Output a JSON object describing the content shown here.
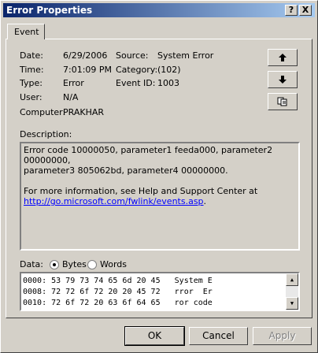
{
  "window": {
    "title": "Error Properties",
    "help_btn": "?",
    "close_btn": "X"
  },
  "tabs": [
    {
      "label": "Event"
    }
  ],
  "event": {
    "date_label": "Date:",
    "date": "6/29/2006",
    "time_label": "Time:",
    "time": "7:01:09 PM",
    "type_label": "Type:",
    "type": "Error",
    "user_label": "User:",
    "user": "N/A",
    "computer_label": "Computer:",
    "computer": "PRAKHAR",
    "source_label": "Source:",
    "source": "System Error",
    "category_label": "Category:",
    "category": "(102)",
    "eventid_label": "Event ID:",
    "eventid": "1003"
  },
  "description": {
    "label": "Description:",
    "line1": "Error code 10000050, parameter1 feeda000, parameter2 00000000,",
    "line2": "parameter3 805062bd, parameter4 00000000.",
    "line3": "For more information, see Help and Support Center at",
    "link": "http://go.microsoft.com/fwlink/events.asp",
    "link_suffix": "."
  },
  "data_section": {
    "label": "Data:",
    "bytes_label": "Bytes",
    "words_label": "Words",
    "selected": "Bytes",
    "rows": [
      "0000: 53 79 73 74 65 6d 20 45   System E",
      "0008: 72 72 6f 72 20 20 45 72   rror  Er",
      "0010: 72 6f 72 20 63 6f 64 65   ror code"
    ]
  },
  "buttons": {
    "ok": "OK",
    "cancel": "Cancel",
    "apply": "Apply"
  }
}
